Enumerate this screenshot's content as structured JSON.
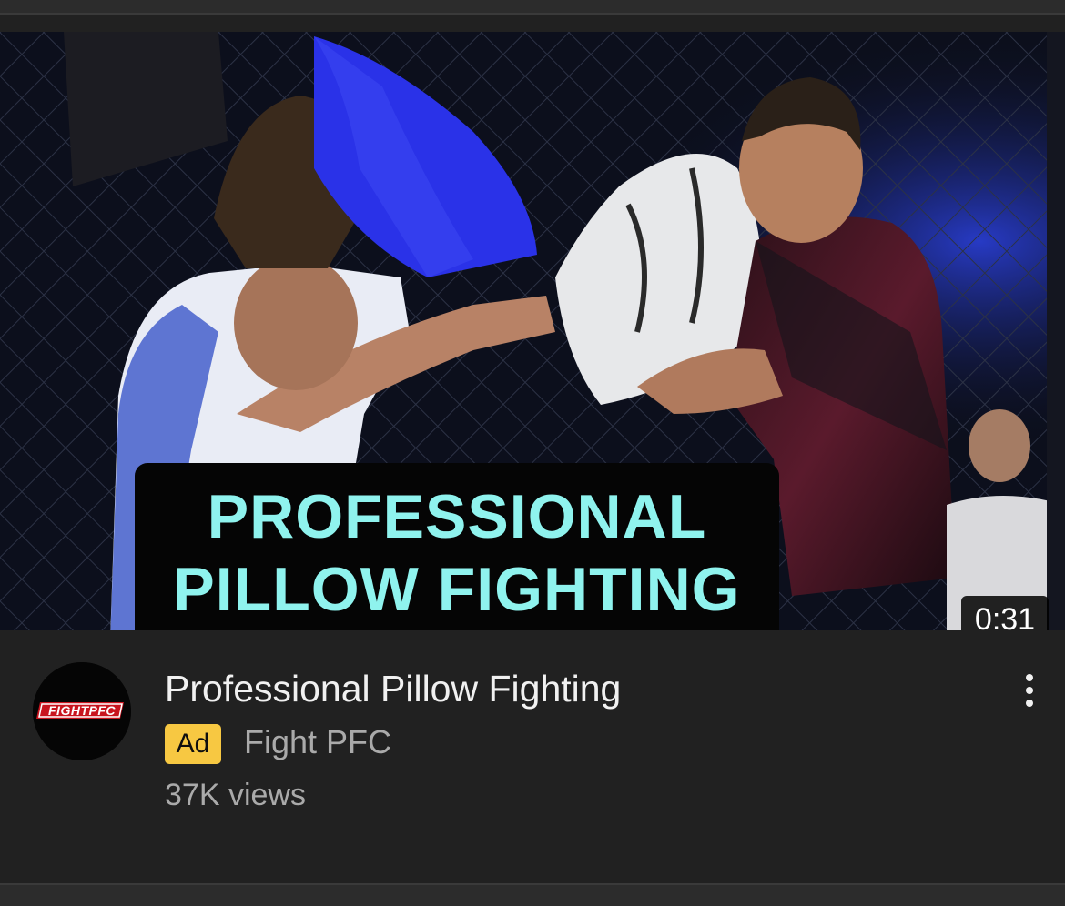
{
  "video": {
    "thumbnail_caption_line1": "PROFESSIONAL",
    "thumbnail_caption_line2": "PILLOW FIGHTING",
    "duration": "0:31",
    "title": "Professional Pillow Fighting",
    "ad_label": "Ad",
    "channel": "Fight PFC",
    "views": "37K views"
  },
  "channel_logo": {
    "text": "FIGHTPFC"
  },
  "menu": {
    "icon": "more-vert-icon"
  },
  "colors": {
    "background": "#212121",
    "caption_text": "#8ff3ee",
    "ad_badge": "#f7c842",
    "secondary_text": "#aaaaaa",
    "primary_text": "#f1f1f1"
  }
}
